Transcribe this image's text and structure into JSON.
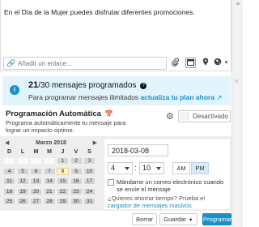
{
  "composer": {
    "text": "En el Día de la Mujer puedes disfrutar diferentes promociones.",
    "link_placeholder": "Añadir un enlace...",
    "icons": [
      "link-icon",
      "attachment-icon",
      "calendar-icon",
      "location-icon",
      "globe-icon",
      "chevron-down-icon"
    ]
  },
  "info": {
    "icon": "i",
    "count": "21",
    "count_suffix": "/30 mensajes programados",
    "help_icon": "?",
    "sub_prefix": "Para programar mensajes ilimitados",
    "sub_link": "actualiza tu plan ahora",
    "external_icon": "↗"
  },
  "auto": {
    "title": "Programación Automática",
    "description": "Programa automáticamente tu mensaje para lograr un impacto óptimo.",
    "toggle_label": "Desactivado"
  },
  "calendar": {
    "prev": "◀",
    "next": "▶",
    "month": "Marzo 2018",
    "weekdays": [
      "D",
      "L",
      "M",
      "M",
      "J",
      "V",
      "S"
    ],
    "weeks": [
      [
        "",
        "",
        "",
        "",
        "1",
        "2",
        "3"
      ],
      [
        "4",
        "5",
        "6",
        "7",
        "8",
        "9",
        "10"
      ],
      [
        "11",
        "12",
        "13",
        "14",
        "15",
        "16",
        "17"
      ],
      [
        "18",
        "19",
        "20",
        "21",
        "22",
        "23",
        "24"
      ],
      [
        "25",
        "26",
        "27",
        "28",
        "29",
        "30",
        "31"
      ]
    ],
    "selected_day": "8"
  },
  "schedule": {
    "date": "2018-03-08",
    "hour": "4",
    "minute": "10",
    "colon": ":",
    "am": "AM",
    "pm": "PM",
    "pm_selected": true,
    "email_label": "Mándame un correo electrónico cuando se envíe el mensaje",
    "save_time_prefix": "¿Quieres ahorrar tiempo? Prueba el",
    "save_time_link": "cargador de mensajes masivos"
  },
  "footer": {
    "borrar": "Borrar",
    "guardar": "Guardar",
    "programar": "Programar"
  },
  "colors": {
    "accent": "#1a8fc8",
    "info_bg": "#e2f4fb",
    "bottom_bg": "#eeeeee"
  }
}
